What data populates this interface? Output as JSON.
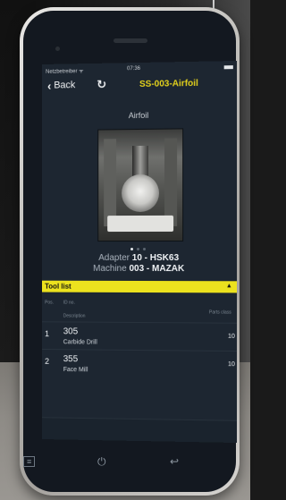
{
  "status_bar": {
    "carrier": "Netzbetreiber ᯤ",
    "time": "07:36"
  },
  "nav": {
    "back_label": "Back",
    "title": "SS-003-Airfoil"
  },
  "page_title": "Airfoil",
  "carousel": {
    "dots": 3,
    "active": 0
  },
  "info": {
    "adapter_label": "Adapter",
    "adapter_value": "10 - HSK63",
    "machine_label": "Machine",
    "machine_value": "003 - MAZAK"
  },
  "tool_list": {
    "title": "Tool list",
    "toggle_icon": "▲",
    "headers": {
      "pos": "Pos.",
      "id": "ID no.",
      "description": "Description",
      "class": "Parts class"
    },
    "rows": [
      {
        "pos": "1",
        "id": "305",
        "description": "Carbide Drill",
        "class": "10"
      },
      {
        "pos": "2",
        "id": "355",
        "description": "Face Mill",
        "class": "10"
      }
    ]
  },
  "hardware_buttons": {
    "menu": "≡",
    "power": "⏻",
    "back": "↩"
  },
  "icons": {
    "back": "chevron-left-icon",
    "refresh": "refresh-icon",
    "toggle": "collapse-icon"
  },
  "colors": {
    "accent": "#e4d21c",
    "section_bar": "#ece21e",
    "screen_bg": "#1d2631"
  }
}
